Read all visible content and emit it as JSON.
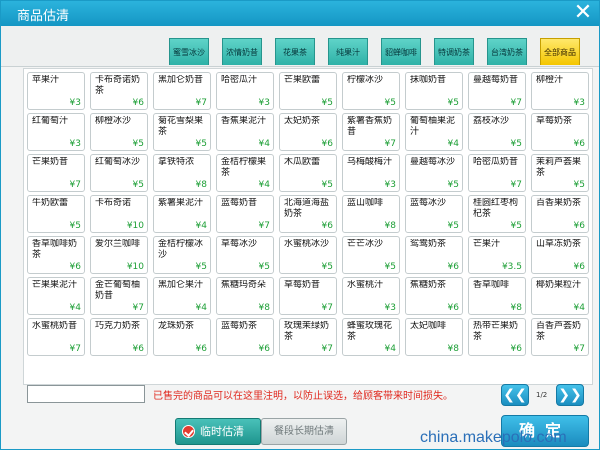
{
  "window": {
    "title": "商品估清",
    "close_icon": "✕"
  },
  "tabs": [
    {
      "label": "蜜雪冰沙",
      "active": false
    },
    {
      "label": "浓情奶昔",
      "active": false
    },
    {
      "label": "花果茶",
      "active": false
    },
    {
      "label": "纯果汁",
      "active": false
    },
    {
      "label": "貂蝉咖啡",
      "active": false
    },
    {
      "label": "特调奶茶",
      "active": false
    },
    {
      "label": "台湾奶茶",
      "active": false
    },
    {
      "label": "全部商品",
      "active": true
    }
  ],
  "products": [
    {
      "name": "苹果汁",
      "price": "¥3"
    },
    {
      "name": "卡布奇诺奶茶",
      "price": "¥6"
    },
    {
      "name": "黑加仑奶昔",
      "price": "¥7"
    },
    {
      "name": "哈密瓜汁",
      "price": "¥3"
    },
    {
      "name": "芒果欧蕾",
      "price": "¥5"
    },
    {
      "name": "柠檬冰沙",
      "price": "¥5"
    },
    {
      "name": "抹咖奶昔",
      "price": "¥5"
    },
    {
      "name": "蔓越莓奶昔",
      "price": "¥7"
    },
    {
      "name": "柳橙汁",
      "price": "¥3"
    },
    {
      "name": "红葡萄汁",
      "price": "¥3"
    },
    {
      "name": "柳橙冰沙",
      "price": "¥5"
    },
    {
      "name": "菊花雪梨果茶",
      "price": "¥5"
    },
    {
      "name": "香蕉果泥汁",
      "price": "¥4"
    },
    {
      "name": "太妃奶茶",
      "price": "¥6"
    },
    {
      "name": "紫薯香蕉奶昔",
      "price": "¥7"
    },
    {
      "name": "葡萄柚果泥汁",
      "price": "¥4"
    },
    {
      "name": "荔枝冰沙",
      "price": "¥5"
    },
    {
      "name": "草莓奶茶",
      "price": "¥6"
    },
    {
      "name": "芒果奶昔",
      "price": "¥7"
    },
    {
      "name": "红葡萄冰沙",
      "price": "¥5"
    },
    {
      "name": "拿铁特浓",
      "price": "¥8"
    },
    {
      "name": "金桔柠檬果茶",
      "price": "¥4"
    },
    {
      "name": "木瓜欧蕾",
      "price": "¥5"
    },
    {
      "name": "乌梅酸梅汁",
      "price": "¥3"
    },
    {
      "name": "蔓越莓冰沙",
      "price": "¥5"
    },
    {
      "name": "哈密瓜奶昔",
      "price": "¥7"
    },
    {
      "name": "茉莉芦荟果茶",
      "price": "¥5"
    },
    {
      "name": "牛奶欧蕾",
      "price": "¥5"
    },
    {
      "name": "卡布奇诺",
      "price": "¥10"
    },
    {
      "name": "紫薯果泥汁",
      "price": "¥4"
    },
    {
      "name": "蓝莓奶昔",
      "price": "¥7"
    },
    {
      "name": "北海道海盐奶茶",
      "price": "¥6"
    },
    {
      "name": "蓝山咖啡",
      "price": "¥8"
    },
    {
      "name": "蓝莓冰沙",
      "price": "¥5"
    },
    {
      "name": "桂圆红枣枸杞茶",
      "price": "¥5"
    },
    {
      "name": "百香果奶茶",
      "price": "¥6"
    },
    {
      "name": "香草咖啡奶茶",
      "price": "¥6"
    },
    {
      "name": "爱尔兰咖啡",
      "price": "¥10"
    },
    {
      "name": "金桔柠檬冰沙",
      "price": "¥5"
    },
    {
      "name": "草莓冰沙",
      "price": "¥5"
    },
    {
      "name": "水蜜桃冰沙",
      "price": "¥5"
    },
    {
      "name": "芒芒冰沙",
      "price": "¥5"
    },
    {
      "name": "鸳鸯奶茶",
      "price": "¥6"
    },
    {
      "name": "芒果汁",
      "price": "¥3.5"
    },
    {
      "name": "山草冻奶茶",
      "price": "¥6"
    },
    {
      "name": "芒果果泥汁",
      "price": "¥4"
    },
    {
      "name": "金芒葡萄柚奶昔",
      "price": "¥7"
    },
    {
      "name": "黑加仑果汁",
      "price": "¥4"
    },
    {
      "name": "蕉糖玛奇朵",
      "price": "¥8"
    },
    {
      "name": "草莓奶昔",
      "price": "¥7"
    },
    {
      "name": "水蜜桃汁",
      "price": "¥3"
    },
    {
      "name": "蕉糖奶茶",
      "price": "¥6"
    },
    {
      "name": "香草咖啡",
      "price": "¥8"
    },
    {
      "name": "椰奶果粒汁",
      "price": "¥4"
    },
    {
      "name": "水蜜桃奶昔",
      "price": "¥7"
    },
    {
      "name": "巧克力奶茶",
      "price": "¥6"
    },
    {
      "name": "龙珠奶茶",
      "price": "¥6"
    },
    {
      "name": "蓝莓奶茶",
      "price": "¥6"
    },
    {
      "name": "玫瑰茉绿奶茶",
      "price": "¥7"
    },
    {
      "name": "蜂蜜玫瑰花茶",
      "price": "¥4"
    },
    {
      "name": "太妃咖啡",
      "price": "¥8"
    },
    {
      "name": "热带芒果奶茶",
      "price": "¥6"
    },
    {
      "name": "百香芦荟奶茶",
      "price": "¥7"
    }
  ],
  "footer": {
    "note_value": "",
    "note_text": "已售完的商品可以在这里注明，以防止误选，给顾客带来时间损失。",
    "prev_label": "❮❮",
    "next_label": "❯❯",
    "page": "1/2",
    "btn_temp_label": "临时估清",
    "btn_long_label": "餐段长期估清",
    "btn_confirm_label": "确定"
  },
  "watermark": "china.makepolo.com",
  "colors": {
    "title_bar": "#1496c4",
    "tab": "#2eb1a7",
    "tab_active": "#f4c600",
    "price": "#1d9f36",
    "note": "#e0281e"
  }
}
